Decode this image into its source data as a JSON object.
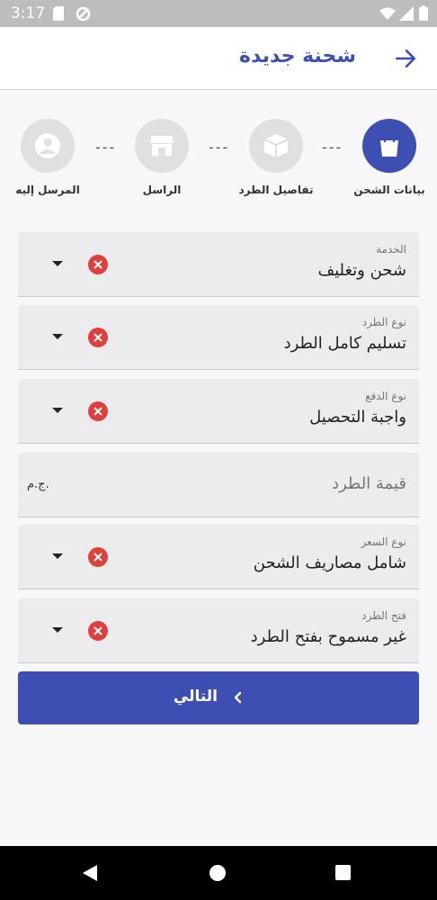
{
  "status_bar": {
    "time": "3:17"
  },
  "header": {
    "title": "شحنة جديدة"
  },
  "stepper": {
    "steps": [
      {
        "label": "بيانات الشحن"
      },
      {
        "label": "تفاصيل الطرد"
      },
      {
        "label": "الراسل"
      },
      {
        "label": "المرسل إليه"
      }
    ],
    "separator": "---"
  },
  "form": {
    "service": {
      "label": "الخدمة",
      "value": "شحن وتغليف"
    },
    "parcel_type": {
      "label": "نوع الطرد",
      "value": "تسليم كامل الطرد"
    },
    "payment_type": {
      "label": "نوع الدفع",
      "value": "واجبة التحصيل"
    },
    "parcel_value": {
      "placeholder": "قيمة الطرد",
      "suffix": "ج.م."
    },
    "price_type": {
      "label": "نوع السعر",
      "value": "شامل مصاريف الشحن"
    },
    "open_parcel": {
      "label": "فتح الطرد",
      "value": "غير مسموح بفتح الطرد"
    }
  },
  "actions": {
    "next_label": "التالي"
  },
  "colors": {
    "accent": "#3d4fb3",
    "clear": "#e0403b"
  }
}
